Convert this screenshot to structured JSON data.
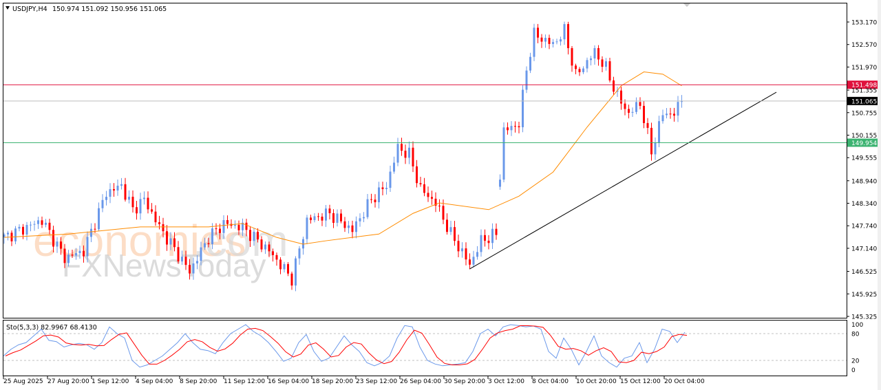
{
  "header": {
    "symbol": "USDJPY,H4",
    "ohlc": "150.974 151.092 150.956 151.065"
  },
  "indicator": {
    "label": "Sto(5,3,3) 82.9967 68.4130",
    "levels": [
      "100",
      "80",
      "20",
      "0"
    ]
  },
  "watermark": {
    "brand1": "economies",
    "brand1_suffix": ".com",
    "brand2": "FXNewsToday"
  },
  "colors": {
    "up": "#6a98ea",
    "down": "#ff0000",
    "ma": "#ff8c00",
    "resistance": "#e0103c",
    "support": "#3cb371",
    "current": "#000000",
    "k": "#6a98ea",
    "d": "#ff0000"
  },
  "chart_data": {
    "type": "candlestick",
    "title": "USDJPY,H4",
    "y_ticks": [
      "153.170",
      "152.570",
      "151.970",
      "151.355",
      "150.755",
      "150.155",
      "149.555",
      "148.940",
      "148.340",
      "147.740",
      "147.140",
      "146.525",
      "145.925",
      "145.325"
    ],
    "ylim": [
      145.325,
      153.17
    ],
    "x_ticks": [
      "25 Aug 2025",
      "27 Aug 20:00",
      "1 Sep 12:00",
      "4 Sep 04:00",
      "8 Sep 20:00",
      "11 Sep 12:00",
      "16 Sep 04:00",
      "18 Sep 20:00",
      "23 Sep 12:00",
      "26 Sep 04:00",
      "30 Sep 20:00",
      "3 Oct 12:00",
      "8 Oct 04:00",
      "10 Oct 20:00",
      "15 Oct 12:00",
      "20 Oct 04:00"
    ],
    "price_path": [
      [
        0,
        147.43
      ],
      [
        10,
        147.89
      ],
      [
        16,
        146.88
      ],
      [
        21,
        147.07
      ],
      [
        27,
        148.62
      ],
      [
        31,
        148.81
      ],
      [
        34,
        148.17
      ],
      [
        37,
        148.44
      ],
      [
        41,
        147.71
      ],
      [
        49,
        146.52
      ],
      [
        54,
        147.43
      ],
      [
        58,
        147.8
      ],
      [
        63,
        147.7
      ],
      [
        70,
        147.07
      ],
      [
        76,
        146.33
      ],
      [
        80,
        147.89
      ],
      [
        86,
        148.07
      ],
      [
        92,
        147.62
      ],
      [
        97,
        148.44
      ],
      [
        101,
        148.81
      ],
      [
        104,
        149.82
      ],
      [
        107,
        149.64
      ],
      [
        110,
        148.72
      ],
      [
        114,
        148.35
      ],
      [
        118,
        147.52
      ],
      [
        123,
        146.7
      ],
      [
        126,
        147.34
      ],
      [
        130,
        147.52
      ],
      [
        131,
        149.08
      ],
      [
        132,
        150.27
      ],
      [
        136,
        150.46
      ],
      [
        138,
        151.93
      ],
      [
        140,
        152.84
      ],
      [
        145,
        152.57
      ],
      [
        148,
        152.93
      ],
      [
        151,
        151.75
      ],
      [
        154,
        152.11
      ],
      [
        156,
        152.38
      ],
      [
        159,
        151.93
      ],
      [
        162,
        151.19
      ],
      [
        165,
        150.73
      ],
      [
        168,
        151.01
      ],
      [
        171,
        149.72
      ],
      [
        174,
        150.73
      ],
      [
        177,
        150.73
      ],
      [
        179,
        151.065
      ]
    ],
    "moving_average": [
      [
        0,
        147.43
      ],
      [
        17,
        147.52
      ],
      [
        36,
        147.71
      ],
      [
        54,
        147.71
      ],
      [
        63,
        147.8
      ],
      [
        72,
        147.43
      ],
      [
        79,
        147.25
      ],
      [
        85,
        147.34
      ],
      [
        99,
        147.52
      ],
      [
        108,
        148.07
      ],
      [
        115,
        148.35
      ],
      [
        128,
        148.17
      ],
      [
        136,
        148.53
      ],
      [
        145,
        149.17
      ],
      [
        154,
        150.37
      ],
      [
        163,
        151.47
      ],
      [
        169,
        151.84
      ],
      [
        174,
        151.78
      ],
      [
        179,
        151.47
      ]
    ],
    "trendline": [
      [
        123,
        146.59
      ],
      [
        204,
        151.3
      ]
    ],
    "horizontal_lines": [
      {
        "price": "151.498",
        "kind": "resistance"
      },
      {
        "price": "151.065",
        "kind": "current"
      },
      {
        "price": "149.954",
        "kind": "support"
      }
    ],
    "stochastic_k": [
      30,
      45,
      55,
      60,
      75,
      90,
      65,
      62,
      50,
      55,
      58,
      55,
      45,
      60,
      95,
      80,
      70,
      20,
      5,
      10,
      20,
      30,
      45,
      60,
      80,
      60,
      45,
      42,
      35,
      60,
      80,
      90,
      100,
      85,
      75,
      60,
      40,
      18,
      25,
      60,
      78,
      40,
      18,
      25,
      50,
      75,
      55,
      40,
      15,
      8,
      15,
      30,
      70,
      98,
      95,
      50,
      20,
      12,
      8,
      10,
      12,
      15,
      40,
      80,
      90,
      75,
      95,
      100,
      98,
      95,
      97,
      90,
      40,
      25,
      70,
      45,
      10,
      40,
      75,
      30,
      15,
      5,
      25,
      30,
      60,
      15,
      45,
      90,
      85,
      60,
      83
    ]
  }
}
